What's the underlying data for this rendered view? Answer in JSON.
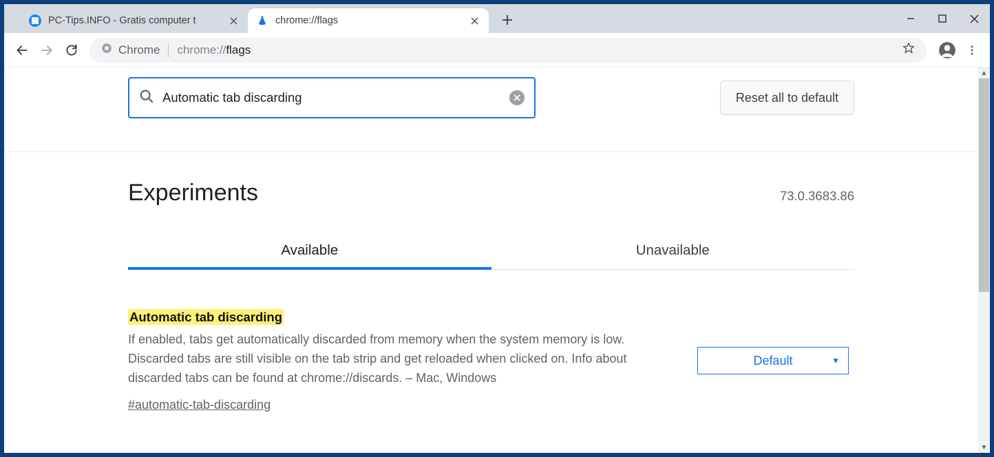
{
  "tabs": {
    "inactive": {
      "title": "PC-Tips.INFO - Gratis computer t"
    },
    "active": {
      "title": "chrome://flags"
    }
  },
  "omnibox": {
    "proto_label": "Chrome",
    "url_host": "chrome://",
    "url_path": "flags"
  },
  "search": {
    "value": "Automatic tab discarding"
  },
  "reset_button": "Reset all to default",
  "experiments_heading": "Experiments",
  "version": "73.0.3683.86",
  "page_tabs": {
    "available": "Available",
    "unavailable": "Unavailable"
  },
  "flag": {
    "title": "Automatic tab discarding",
    "description": "If enabled, tabs get automatically discarded from memory when the system memory is low. Discarded tabs are still visible on the tab strip and get reloaded when clicked on. Info about discarded tabs can be found at chrome://discards. – Mac, Windows",
    "hash": "#automatic-tab-discarding",
    "select_value": "Default"
  }
}
